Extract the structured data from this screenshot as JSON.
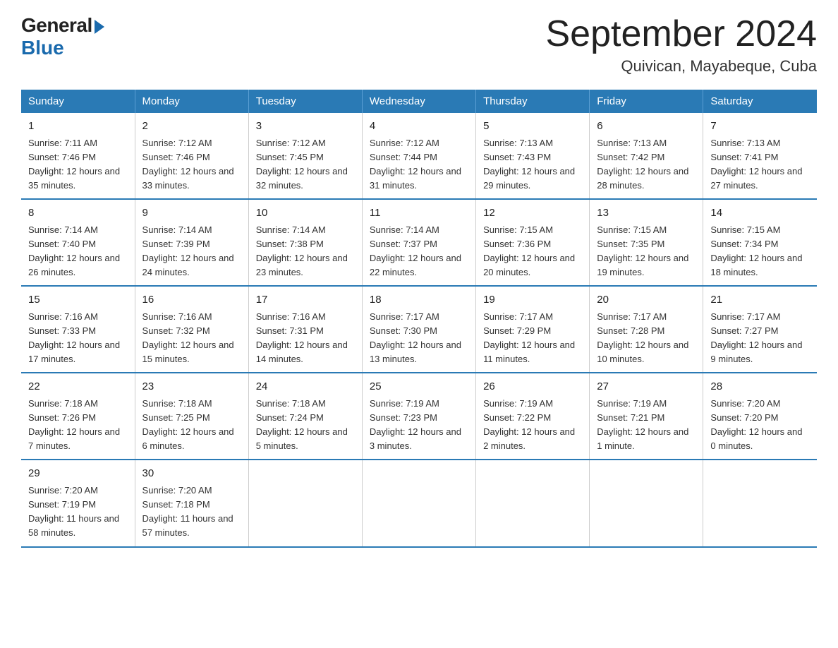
{
  "logo": {
    "general": "General",
    "blue": "Blue"
  },
  "title": "September 2024",
  "subtitle": "Quivican, Mayabeque, Cuba",
  "days_header": [
    "Sunday",
    "Monday",
    "Tuesday",
    "Wednesday",
    "Thursday",
    "Friday",
    "Saturday"
  ],
  "weeks": [
    [
      {
        "day": "1",
        "sunrise": "7:11 AM",
        "sunset": "7:46 PM",
        "daylight": "12 hours and 35 minutes."
      },
      {
        "day": "2",
        "sunrise": "7:12 AM",
        "sunset": "7:46 PM",
        "daylight": "12 hours and 33 minutes."
      },
      {
        "day": "3",
        "sunrise": "7:12 AM",
        "sunset": "7:45 PM",
        "daylight": "12 hours and 32 minutes."
      },
      {
        "day": "4",
        "sunrise": "7:12 AM",
        "sunset": "7:44 PM",
        "daylight": "12 hours and 31 minutes."
      },
      {
        "day": "5",
        "sunrise": "7:13 AM",
        "sunset": "7:43 PM",
        "daylight": "12 hours and 29 minutes."
      },
      {
        "day": "6",
        "sunrise": "7:13 AM",
        "sunset": "7:42 PM",
        "daylight": "12 hours and 28 minutes."
      },
      {
        "day": "7",
        "sunrise": "7:13 AM",
        "sunset": "7:41 PM",
        "daylight": "12 hours and 27 minutes."
      }
    ],
    [
      {
        "day": "8",
        "sunrise": "7:14 AM",
        "sunset": "7:40 PM",
        "daylight": "12 hours and 26 minutes."
      },
      {
        "day": "9",
        "sunrise": "7:14 AM",
        "sunset": "7:39 PM",
        "daylight": "12 hours and 24 minutes."
      },
      {
        "day": "10",
        "sunrise": "7:14 AM",
        "sunset": "7:38 PM",
        "daylight": "12 hours and 23 minutes."
      },
      {
        "day": "11",
        "sunrise": "7:14 AM",
        "sunset": "7:37 PM",
        "daylight": "12 hours and 22 minutes."
      },
      {
        "day": "12",
        "sunrise": "7:15 AM",
        "sunset": "7:36 PM",
        "daylight": "12 hours and 20 minutes."
      },
      {
        "day": "13",
        "sunrise": "7:15 AM",
        "sunset": "7:35 PM",
        "daylight": "12 hours and 19 minutes."
      },
      {
        "day": "14",
        "sunrise": "7:15 AM",
        "sunset": "7:34 PM",
        "daylight": "12 hours and 18 minutes."
      }
    ],
    [
      {
        "day": "15",
        "sunrise": "7:16 AM",
        "sunset": "7:33 PM",
        "daylight": "12 hours and 17 minutes."
      },
      {
        "day": "16",
        "sunrise": "7:16 AM",
        "sunset": "7:32 PM",
        "daylight": "12 hours and 15 minutes."
      },
      {
        "day": "17",
        "sunrise": "7:16 AM",
        "sunset": "7:31 PM",
        "daylight": "12 hours and 14 minutes."
      },
      {
        "day": "18",
        "sunrise": "7:17 AM",
        "sunset": "7:30 PM",
        "daylight": "12 hours and 13 minutes."
      },
      {
        "day": "19",
        "sunrise": "7:17 AM",
        "sunset": "7:29 PM",
        "daylight": "12 hours and 11 minutes."
      },
      {
        "day": "20",
        "sunrise": "7:17 AM",
        "sunset": "7:28 PM",
        "daylight": "12 hours and 10 minutes."
      },
      {
        "day": "21",
        "sunrise": "7:17 AM",
        "sunset": "7:27 PM",
        "daylight": "12 hours and 9 minutes."
      }
    ],
    [
      {
        "day": "22",
        "sunrise": "7:18 AM",
        "sunset": "7:26 PM",
        "daylight": "12 hours and 7 minutes."
      },
      {
        "day": "23",
        "sunrise": "7:18 AM",
        "sunset": "7:25 PM",
        "daylight": "12 hours and 6 minutes."
      },
      {
        "day": "24",
        "sunrise": "7:18 AM",
        "sunset": "7:24 PM",
        "daylight": "12 hours and 5 minutes."
      },
      {
        "day": "25",
        "sunrise": "7:19 AM",
        "sunset": "7:23 PM",
        "daylight": "12 hours and 3 minutes."
      },
      {
        "day": "26",
        "sunrise": "7:19 AM",
        "sunset": "7:22 PM",
        "daylight": "12 hours and 2 minutes."
      },
      {
        "day": "27",
        "sunrise": "7:19 AM",
        "sunset": "7:21 PM",
        "daylight": "12 hours and 1 minute."
      },
      {
        "day": "28",
        "sunrise": "7:20 AM",
        "sunset": "7:20 PM",
        "daylight": "12 hours and 0 minutes."
      }
    ],
    [
      {
        "day": "29",
        "sunrise": "7:20 AM",
        "sunset": "7:19 PM",
        "daylight": "11 hours and 58 minutes."
      },
      {
        "day": "30",
        "sunrise": "7:20 AM",
        "sunset": "7:18 PM",
        "daylight": "11 hours and 57 minutes."
      },
      null,
      null,
      null,
      null,
      null
    ]
  ]
}
